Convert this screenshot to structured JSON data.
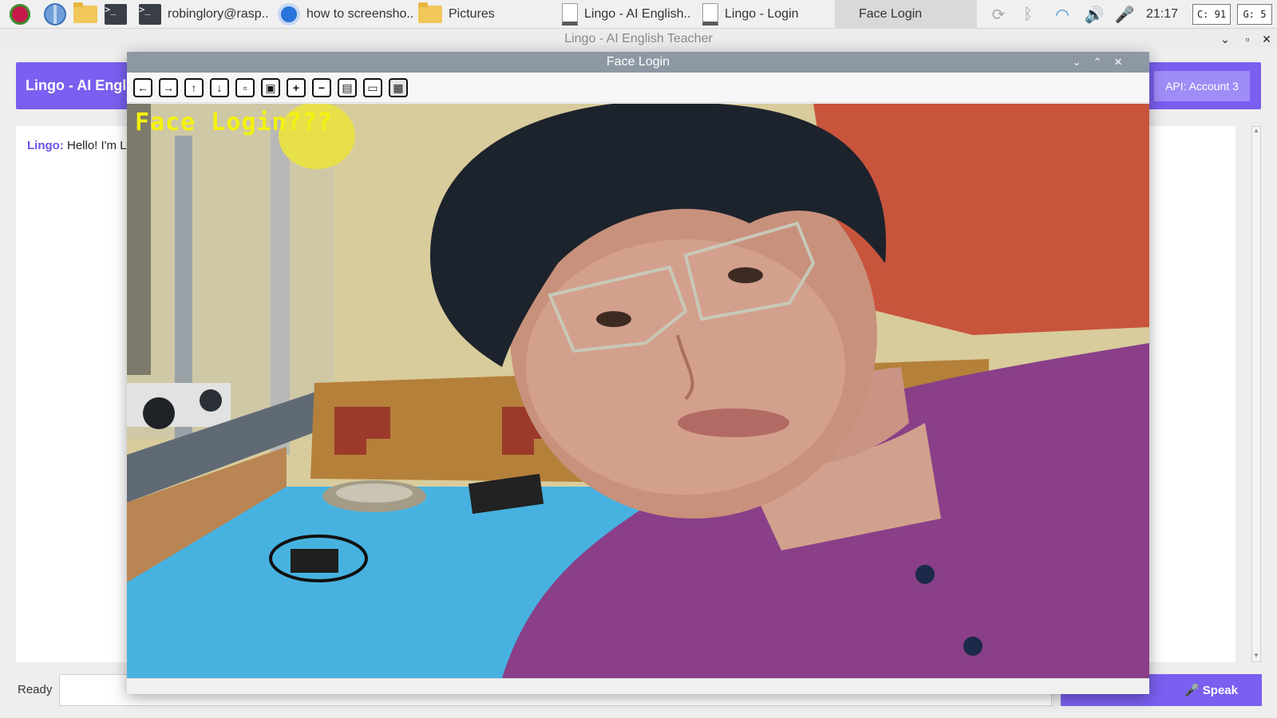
{
  "taskbar": {
    "items": [
      {
        "name": "raspberry-menu",
        "label": ""
      },
      {
        "name": "browser-launcher",
        "label": ""
      },
      {
        "name": "file-manager-launcher",
        "label": ""
      },
      {
        "name": "terminal-launcher",
        "label": ""
      },
      {
        "name": "terminal-window",
        "label": "robinglory@rasp.."
      },
      {
        "name": "chromium-window",
        "label": "how to screensho.."
      },
      {
        "name": "pictures-window",
        "label": "Pictures"
      },
      {
        "name": "lingo-teacher-window",
        "label": "Lingo - AI English.."
      },
      {
        "name": "lingo-login-window",
        "label": "Lingo - Login"
      },
      {
        "name": "face-login-window",
        "label": "Face Login"
      }
    ],
    "clock": "21:17",
    "cpu_meter": "C: 91",
    "gpu_meter": "G: 5"
  },
  "app": {
    "window_title": "Lingo - AI English Teacher",
    "header_title": "Lingo - AI Engli",
    "api_button": "API: Account 3",
    "chat": {
      "speaker": "Lingo:",
      "message": "Hello! I'm L"
    },
    "status": "Ready",
    "input_value": "",
    "speak_button": "🎤 Speak"
  },
  "face_window": {
    "title": "Face Login",
    "overlay_text": "Face  Login???",
    "toolbar": [
      {
        "name": "pan-left-button",
        "glyph": "←"
      },
      {
        "name": "pan-right-button",
        "glyph": "→"
      },
      {
        "name": "pan-up-button",
        "glyph": "↑"
      },
      {
        "name": "pan-down-button",
        "glyph": "↓"
      },
      {
        "name": "zoom-in-fit-button",
        "glyph": "▫"
      },
      {
        "name": "zoom-original-button",
        "glyph": "▣"
      },
      {
        "name": "zoom-in-button",
        "glyph": "+"
      },
      {
        "name": "zoom-out-button",
        "glyph": "−"
      },
      {
        "name": "save-image-button",
        "glyph": "▤"
      },
      {
        "name": "copy-image-button",
        "glyph": "▭"
      },
      {
        "name": "properties-button",
        "glyph": "▦"
      }
    ]
  },
  "colors": {
    "accent": "#7a5ff0",
    "api_button": "#a08cf7",
    "overlay_text": "#f4f20c",
    "face_titlebar": "#8d98a4"
  }
}
